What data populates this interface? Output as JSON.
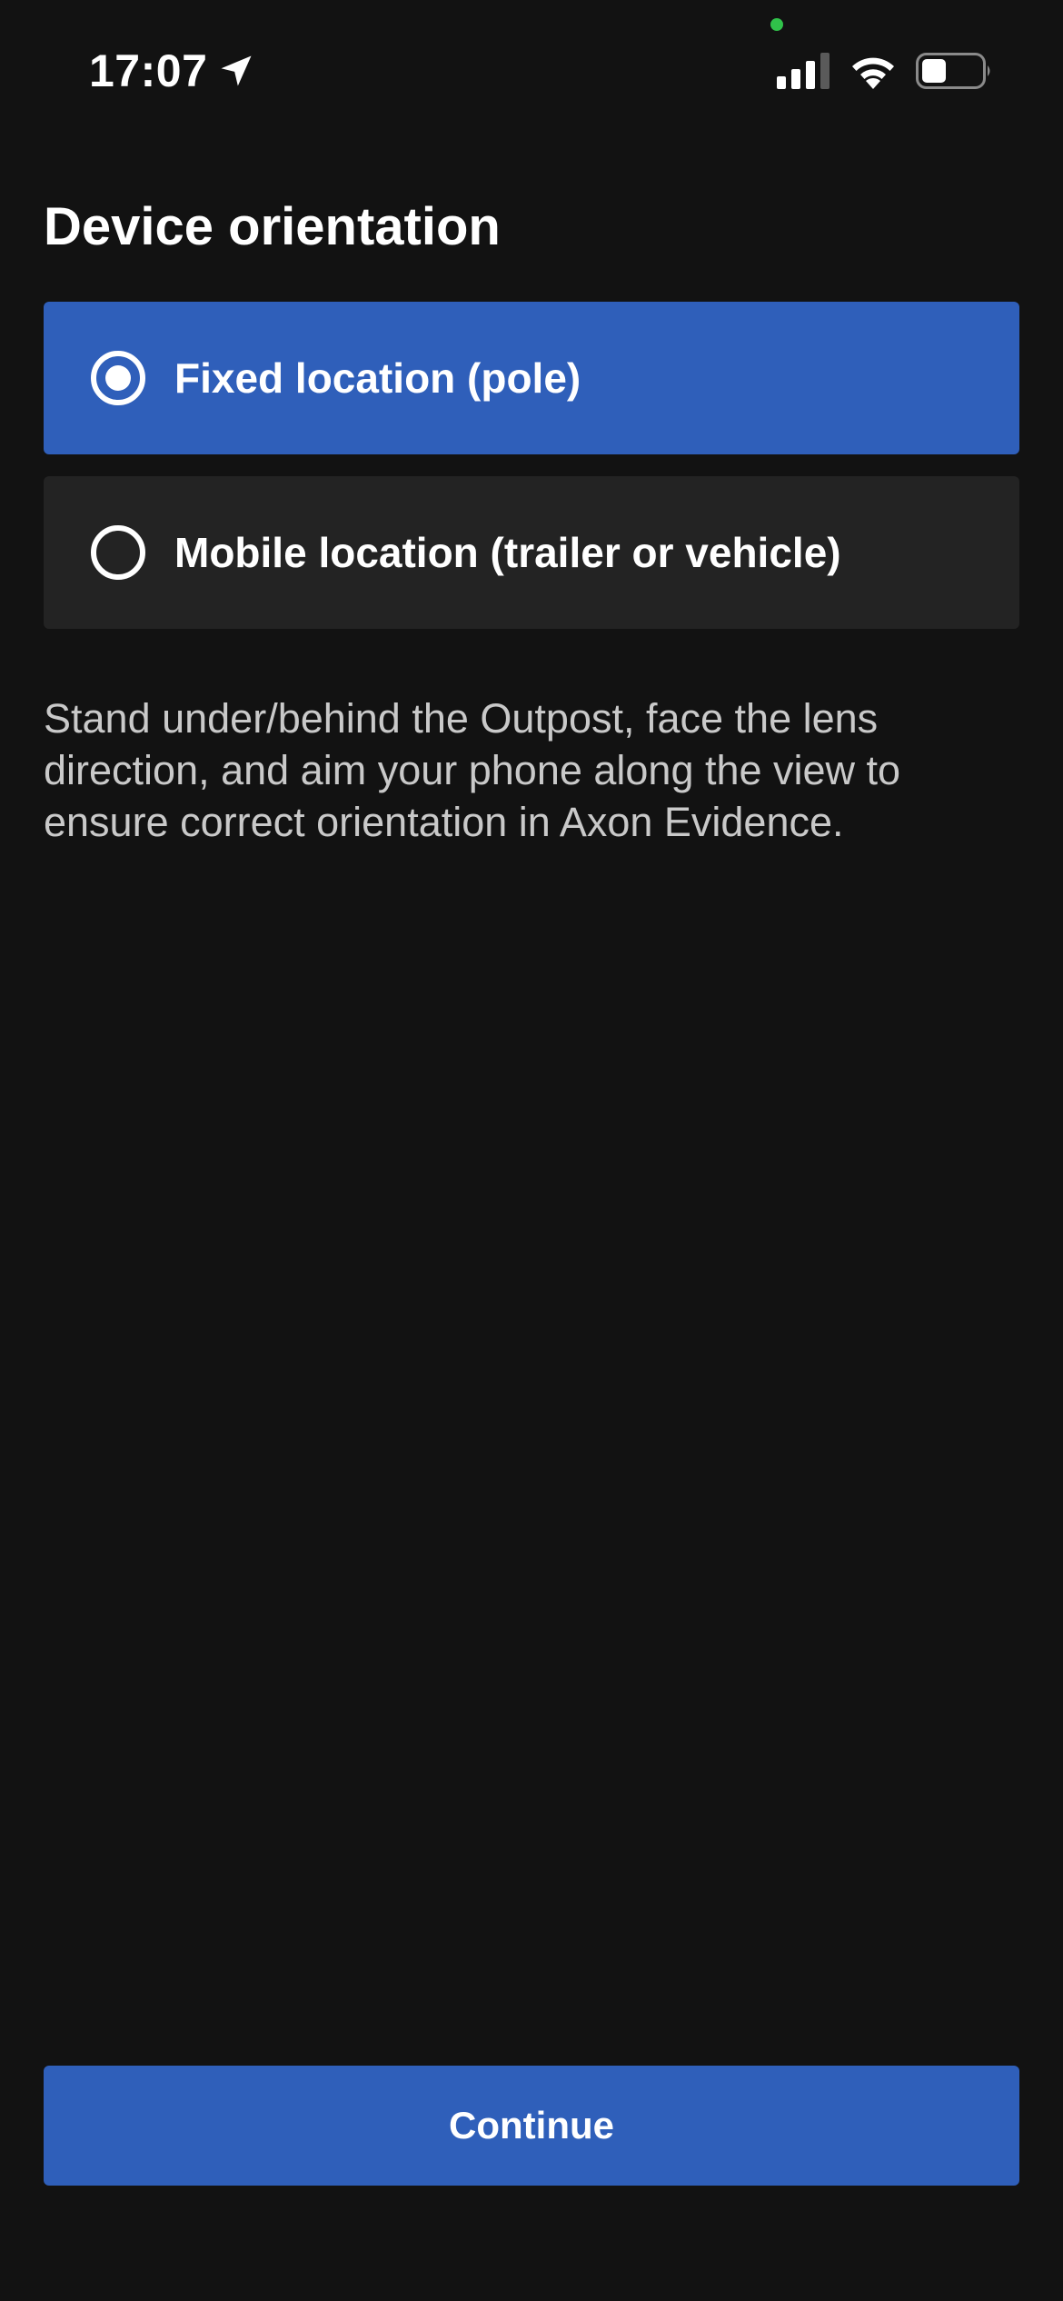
{
  "status_bar": {
    "time": "17:07",
    "icons": [
      "location-arrow-icon",
      "signal-icon",
      "wifi-icon",
      "battery-icon"
    ],
    "privacy_dot_color": "#30c24a"
  },
  "page": {
    "title": "Device orientation",
    "instructions": "Stand under/behind the Outpost, face the lens direction, and aim your phone along the view to ensure correct orientation in Axon Evidence."
  },
  "orientation_options": [
    {
      "label": "Fixed location (pole)",
      "selected": true
    },
    {
      "label": "Mobile location (trailer or vehicle)",
      "selected": false
    }
  ],
  "continue_button": {
    "label": "Continue"
  },
  "colors": {
    "background": "#121212",
    "accent": "#2f5fba",
    "unselected_option": "#232323",
    "text_primary": "#ffffff",
    "text_secondary": "#c9c9c9"
  }
}
